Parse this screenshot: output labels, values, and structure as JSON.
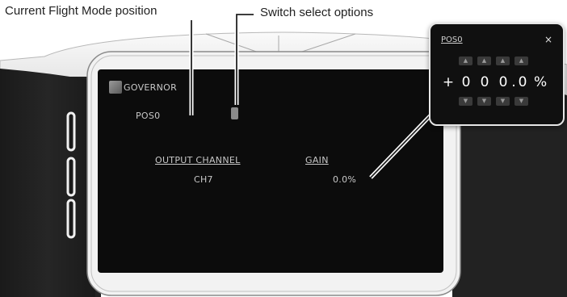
{
  "callouts": {
    "flight_mode": "Current Flight Mode position",
    "switch_select": "Switch select options"
  },
  "screen": {
    "title": "GOVERNOR",
    "flight_mode_value": "POS0",
    "switch_icon": "switch-toggle-icon",
    "output_channel_label": "OUTPUT CHANNEL",
    "output_channel_value": "CH7",
    "gain_label": "GAIN",
    "gain_value": "0.0%"
  },
  "popup": {
    "title": "POS0",
    "close_label": "×",
    "sign": "+",
    "digits": [
      "0",
      "0",
      "0",
      "."
    ],
    "last_digit": "0",
    "unit": "%",
    "up_arrow": "▲",
    "down_arrow": "▼"
  }
}
